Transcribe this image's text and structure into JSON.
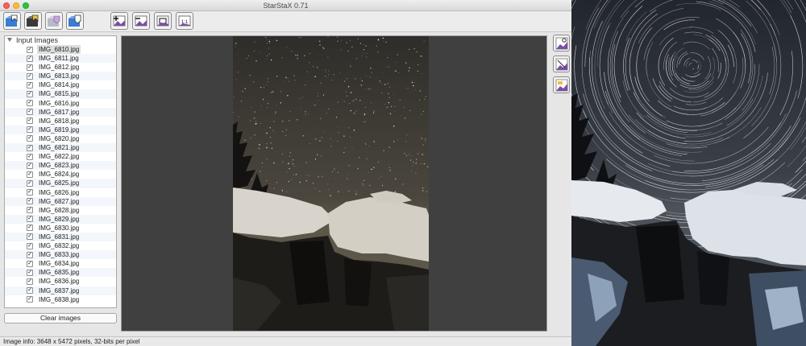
{
  "window": {
    "title": "StarStaX 0.71"
  },
  "toolbar": {
    "buttons": [
      {
        "icon": "open-images-icon",
        "tip": ""
      },
      {
        "icon": "open-darks-icon",
        "tip": ""
      },
      {
        "icon": "save-image-icon",
        "tip": ""
      },
      {
        "icon": "save-as-icon",
        "tip": ""
      },
      {
        "icon": "start-blending-icon",
        "tip": ""
      },
      {
        "icon": "stop-icon",
        "tip": ""
      },
      {
        "icon": "preferences-icon",
        "tip": ""
      },
      {
        "icon": "zoom-fit-icon",
        "tip": ""
      }
    ]
  },
  "input_panel": {
    "header": "Input Images",
    "files": [
      "IMG_6810.jpg",
      "IMG_6811.jpg",
      "IMG_6812.jpg",
      "IMG_6813.jpg",
      "IMG_6814.jpg",
      "IMG_6815.jpg",
      "IMG_6816.jpg",
      "IMG_6817.jpg",
      "IMG_6818.jpg",
      "IMG_6819.jpg",
      "IMG_6820.jpg",
      "IMG_6821.jpg",
      "IMG_6822.jpg",
      "IMG_6823.jpg",
      "IMG_6824.jpg",
      "IMG_6825.jpg",
      "IMG_6826.jpg",
      "IMG_6827.jpg",
      "IMG_6828.jpg",
      "IMG_6829.jpg",
      "IMG_6830.jpg",
      "IMG_6831.jpg",
      "IMG_6832.jpg",
      "IMG_6833.jpg",
      "IMG_6834.jpg",
      "IMG_6835.jpg",
      "IMG_6836.jpg",
      "IMG_6837.jpg",
      "IMG_6838.jpg"
    ],
    "selected_index": 0,
    "check_mark": "✓",
    "clear_button": "Clear images"
  },
  "side_buttons": [
    {
      "icon": "blend-mode-icon"
    },
    {
      "icon": "gap-filling-icon"
    },
    {
      "icon": "dark-frame-icon"
    }
  ],
  "status": {
    "text": "Image info: 3648 x 5472 pixels, 32-bits per pixel"
  },
  "colors": {
    "accent_blue": "#3a7bd5",
    "accent_purple": "#7a4fa3"
  }
}
